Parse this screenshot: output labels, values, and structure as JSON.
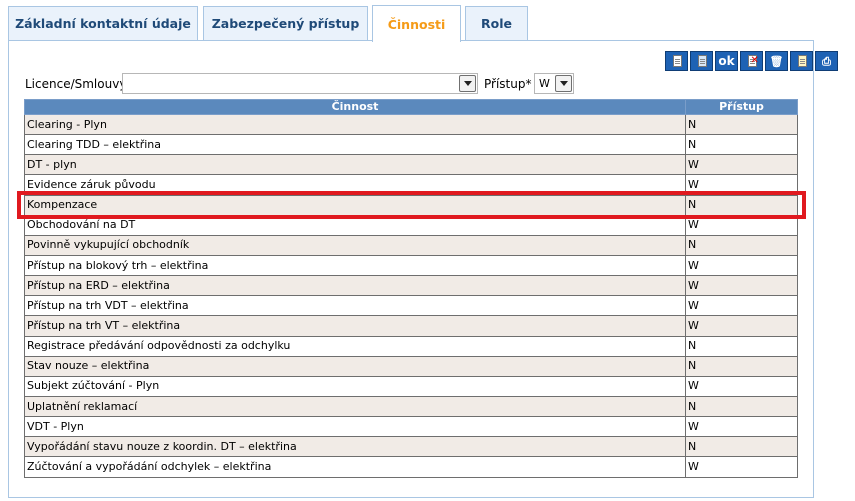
{
  "tabs": [
    {
      "label": "Základní kontaktní údaje",
      "active": false
    },
    {
      "label": "Zabezpečený přístup",
      "active": false
    },
    {
      "label": "Činnosti",
      "active": true
    },
    {
      "label": "Role",
      "active": false
    }
  ],
  "toolbar": {
    "buttons": [
      {
        "name": "new-record-icon"
      },
      {
        "name": "edit-record-icon"
      },
      {
        "name": "ok",
        "label": "ok"
      },
      {
        "name": "cancel-record-icon"
      },
      {
        "name": "delete-trash-icon"
      },
      {
        "name": "export-icon"
      },
      {
        "name": "print-icon"
      }
    ]
  },
  "filters": {
    "license_label": "Licence/Smlouvy",
    "license_value": "",
    "access_label": "Přístup*",
    "access_value": "W"
  },
  "grid": {
    "headers": {
      "activity": "Činnost",
      "access": "Přístup"
    },
    "rows": [
      {
        "activity": "Clearing - Plyn",
        "access": "N"
      },
      {
        "activity": "Clearing TDD – elektřina",
        "access": "N"
      },
      {
        "activity": "DT - plyn",
        "access": "W"
      },
      {
        "activity": "Evidence záruk původu",
        "access": "W"
      },
      {
        "activity": "Kompenzace",
        "access": "N"
      },
      {
        "activity": "Obchodování na DT",
        "access": "W"
      },
      {
        "activity": "Povinně vykupující obchodník",
        "access": "N"
      },
      {
        "activity": "Přístup na blokový trh – elektřina",
        "access": "W"
      },
      {
        "activity": "Přístup na ERD – elektřina",
        "access": "W"
      },
      {
        "activity": "Přístup na trh VDT – elektřina",
        "access": "W"
      },
      {
        "activity": "Přístup na trh VT – elektřina",
        "access": "W"
      },
      {
        "activity": "Registrace předávání odpovědnosti za odchylku",
        "access": "N"
      },
      {
        "activity": "Stav nouze – elektřina",
        "access": "N"
      },
      {
        "activity": "Subjekt zúčtování - Plyn",
        "access": "W"
      },
      {
        "activity": "Uplatnění reklamací",
        "access": "N"
      },
      {
        "activity": "VDT - Plyn",
        "access": "W"
      },
      {
        "activity": "Vypořádání stavu nouze z koordin. DT – elektřina",
        "access": "N"
      },
      {
        "activity": "Zúčtování a vypořádání odchylek – elektřina",
        "access": "W"
      }
    ],
    "highlighted_row": 4
  },
  "colors": {
    "active_tab_text": "#f59b17",
    "header_bg": "#5b89bd",
    "highlight_border": "#e0191f",
    "toolbar_button_bg": "#1e62b4"
  }
}
